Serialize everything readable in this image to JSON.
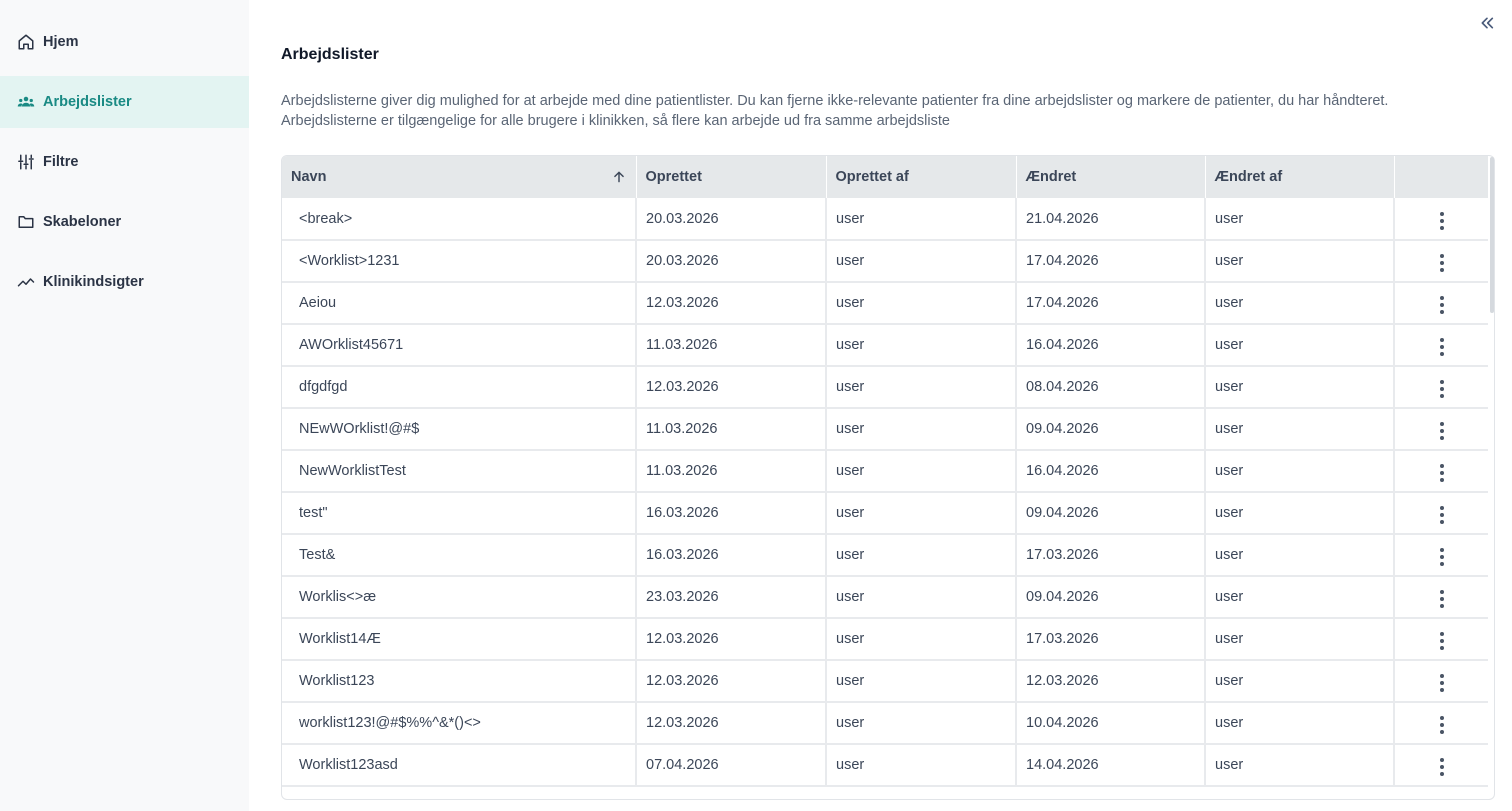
{
  "sidebar": {
    "items": [
      {
        "label": "Hjem",
        "icon": "home-icon",
        "active": false
      },
      {
        "label": "Arbejdslister",
        "icon": "users-icon",
        "active": true
      },
      {
        "label": "Filtre",
        "icon": "sliders-icon",
        "active": false
      },
      {
        "label": "Skabeloner",
        "icon": "folder-icon",
        "active": false
      },
      {
        "label": "Klinikindsigter",
        "icon": "trend-line-icon",
        "active": false
      }
    ]
  },
  "header": {
    "collapse_icon": "double-chevron-left-icon"
  },
  "main": {
    "title": "Arbejdslister",
    "description": "Arbejdslisterne giver dig mulighed for at arbejde med dine patientlister. Du kan fjerne ikke-relevante patienter fra dine arbejdslister og markere de patienter, du har håndteret. Arbejdslisterne er tilgængelige for alle brugere i klinikken, så flere kan arbejde ud fra samme arbejdsliste"
  },
  "table": {
    "columns": [
      "Navn",
      "Oprettet",
      "Oprettet af",
      "Ændret",
      "Ændret af",
      ""
    ],
    "sort_column": "Navn",
    "sort_direction": "ascending",
    "rows": [
      [
        "<break>",
        "20.03.2026",
        "user",
        "21.04.2026",
        "user"
      ],
      [
        "<Worklist>1231",
        "20.03.2026",
        "user",
        "17.04.2026",
        "user"
      ],
      [
        "Aeiou",
        "12.03.2026",
        "user",
        "17.04.2026",
        "user"
      ],
      [
        "AWOrklist45671",
        "11.03.2026",
        "user",
        "16.04.2026",
        "user"
      ],
      [
        "dfgdfgd",
        "12.03.2026",
        "user",
        "08.04.2026",
        "user"
      ],
      [
        "NEwWOrklist!@#$",
        "11.03.2026",
        "user",
        "09.04.2026",
        "user"
      ],
      [
        "NewWorklistTest",
        "11.03.2026",
        "user",
        "16.04.2026",
        "user"
      ],
      [
        "test\"",
        "16.03.2026",
        "user",
        "09.04.2026",
        "user"
      ],
      [
        "Test&",
        "16.03.2026",
        "user",
        "17.03.2026",
        "user"
      ],
      [
        "Worklis<>æ",
        "23.03.2026",
        "user",
        "09.04.2026",
        "user"
      ],
      [
        "Worklist14Æ",
        "12.03.2026",
        "user",
        "17.03.2026",
        "user"
      ],
      [
        "Worklist123",
        "12.03.2026",
        "user",
        "12.03.2026",
        "user"
      ],
      [
        "worklist123!@#$%%^&*()<>",
        "12.03.2026",
        "user",
        "10.04.2026",
        "user"
      ],
      [
        "Worklist123asd",
        "07.04.2026",
        "user",
        "14.04.2026",
        "user"
      ]
    ]
  },
  "colors": {
    "accent": "#1a8a84",
    "active_bg": "#e3f4f2",
    "sidebar_bg": "#f8f9fa",
    "header_bg": "#e5e8ea"
  }
}
